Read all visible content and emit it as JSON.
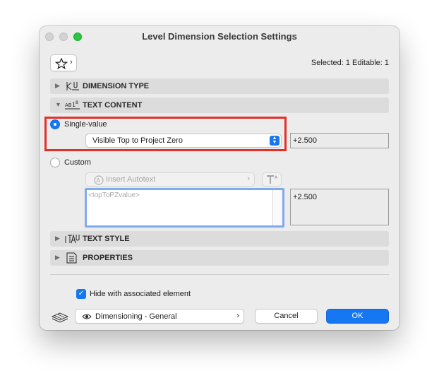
{
  "window": {
    "title": "Level Dimension Selection Settings"
  },
  "header": {
    "selected_info": "Selected: 1 Editable: 1"
  },
  "sections": {
    "dimension_type": "DIMENSION TYPE",
    "text_content": "TEXT CONTENT",
    "text_style": "TEXT STYLE",
    "properties": "PROPERTIES"
  },
  "text_content": {
    "single_value_label": "Single-value",
    "single_value_selected": true,
    "single_value_option": "Visible Top to Project Zero",
    "single_value_preview": "+2.500",
    "custom_label": "Custom",
    "insert_autotext_label": "Insert Autotext",
    "custom_text": "<topToPZvalue>",
    "custom_preview": "+2.500"
  },
  "footer": {
    "hide_with_element_label": "Hide with associated element",
    "hide_with_element_checked": true,
    "layer_value": "Dimensioning - General",
    "cancel_label": "Cancel",
    "ok_label": "OK"
  },
  "colors": {
    "accent": "#1776f2",
    "highlight": "#e5302a"
  }
}
